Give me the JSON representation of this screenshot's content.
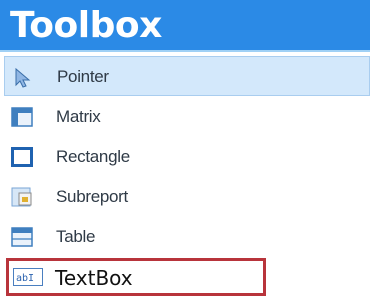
{
  "toolbox": {
    "title": "Toolbox",
    "items": [
      {
        "label": "Pointer",
        "icon": "pointer-icon",
        "selected": true
      },
      {
        "label": "Matrix",
        "icon": "matrix-icon"
      },
      {
        "label": "Rectangle",
        "icon": "rectangle-icon"
      },
      {
        "label": "Subreport",
        "icon": "subreport-icon"
      },
      {
        "label": "Table",
        "icon": "table-icon"
      },
      {
        "label": "TextBox",
        "icon": "textbox-icon",
        "highlighted": true
      }
    ],
    "textbox_icon_text": "abI"
  },
  "colors": {
    "title_bar": "#2b8ae6",
    "selected_bg": "#d3e8fb",
    "highlight_border": "#b8343b"
  }
}
